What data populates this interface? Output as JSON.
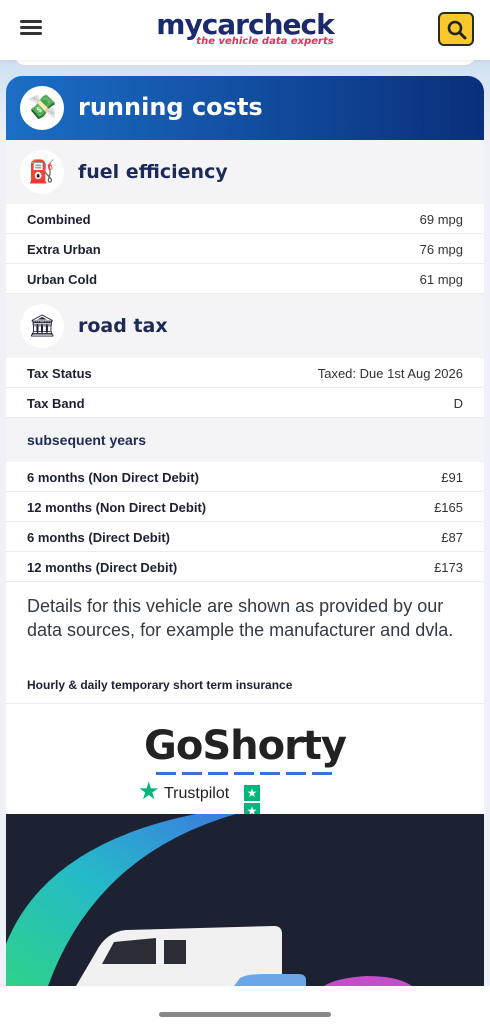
{
  "header": {
    "logo_main": "mycarcheck",
    "logo_sub": "the vehicle data experts"
  },
  "card": {
    "title": "running costs"
  },
  "fuel": {
    "title": "fuel efficiency",
    "rows": [
      {
        "label": "Combined",
        "value": "69 mpg"
      },
      {
        "label": "Extra Urban",
        "value": "76 mpg"
      },
      {
        "label": "Urban Cold",
        "value": "61 mpg"
      }
    ]
  },
  "tax": {
    "title": "road tax",
    "rows": [
      {
        "label": "Tax Status",
        "value": "Taxed: Due 1st Aug 2026"
      },
      {
        "label": "Tax Band",
        "value": "D"
      }
    ],
    "subsequent_title": "subsequent years",
    "subsequent": [
      {
        "label": "6 months (Non Direct Debit)",
        "value": "£91"
      },
      {
        "label": "12 months (Non Direct Debit)",
        "value": "£165"
      },
      {
        "label": "6 months (Direct Debit)",
        "value": "£87"
      },
      {
        "label": "12 months (Direct Debit)",
        "value": "£173"
      }
    ]
  },
  "disclaimer": "Details for this vehicle are shown as provided by our data sources, for example the manufacturer and dvla.",
  "insurance_label": "Hourly & daily temporary short term insurance",
  "ad": {
    "brand": "GoShorty",
    "trustpilot": "Trustpilot",
    "rating_stars": 5
  },
  "colors": {
    "header_gradient_start": "#1b6ec6",
    "header_gradient_end": "#0a2f7c",
    "search_button": "#f9c82a",
    "trustpilot_green": "#00b67a",
    "logo_sub": "#e0315b"
  }
}
